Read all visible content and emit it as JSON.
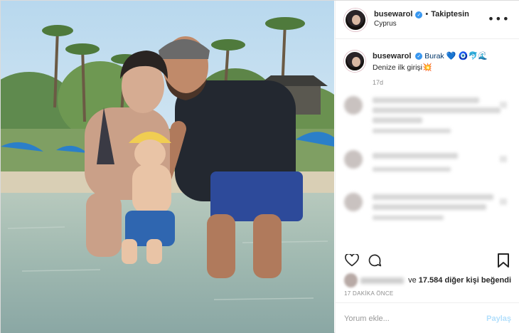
{
  "header": {
    "username": "busewarol",
    "separator": "•",
    "follow_label": "Takiptesin",
    "location": "Cyprus",
    "more_label": "•••"
  },
  "caption": {
    "username": "busewarol",
    "mention": "Burak",
    "mention_emojis": "💙 🧿🐬🌊",
    "text": "Denize ilk girişi",
    "text_emoji": "💥",
    "age": "17d"
  },
  "icons": {
    "verified": "check-badge",
    "like": "heart-outline-icon",
    "comment": "speech-bubble-icon",
    "save": "bookmark-outline-icon",
    "more": "ellipsis-icon"
  },
  "likes": {
    "suffix_pre": "ve ",
    "count": "17.584",
    "suffix_post": " diğer kişi beğendi"
  },
  "post_time": "17 DAKİKA ÖNCE",
  "comment_box": {
    "placeholder": "Yorum ekle...",
    "post_label": "Paylaş"
  },
  "colors": {
    "verified_blue": "#3897f0",
    "post_button_disabled": "#b2dffc",
    "secondary_text": "#8e8e8e",
    "border": "#efefef"
  }
}
